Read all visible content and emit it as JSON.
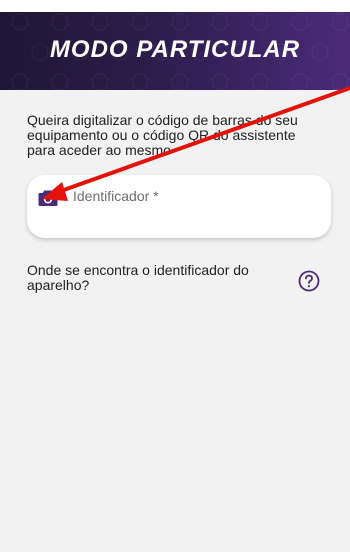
{
  "header": {
    "title": "MODO PARTICULAR"
  },
  "main": {
    "instructions": "Queira digitalizar o código de barras do seu equipamento ou o código QR do assistente para aceder ao mesmo",
    "identifier_field": {
      "placeholder": "Identificador *",
      "value": ""
    },
    "help": {
      "text": "Onde se encontra o identificador do aparelho?"
    }
  },
  "icons": {
    "camera": "camera-icon",
    "help": "question-circle-icon"
  },
  "colors": {
    "accent": "#4b2b7a",
    "header_dark": "#1f1636",
    "annotation_arrow": "#e3120b"
  }
}
